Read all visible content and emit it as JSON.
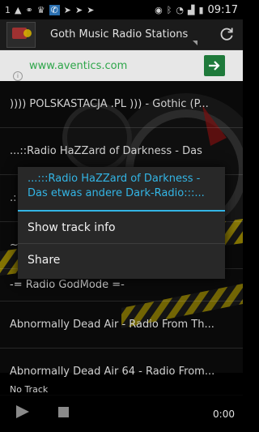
{
  "status_bar": {
    "icons": [
      "notification-1",
      "alert-icon",
      "usb-icon",
      "tux-icon",
      "app-icon",
      "send-icon",
      "send-icon",
      "send-icon"
    ],
    "right_icons": [
      "eye-icon",
      "bluetooth-icon",
      "wifi-icon",
      "signal-icon",
      "battery-icon"
    ],
    "time": "09:17"
  },
  "actionbar": {
    "title": "Goth Music Radio Stations"
  },
  "ad": {
    "url": "www.aventics.com"
  },
  "list": {
    "items": [
      ")))) POLSKASTACJA .PL ))) - Gothic (P...",
      "...::Radio HaZZard of Darkness - Das",
      ".::...",
      "~ ~",
      "-= Radio GodMode =-",
      "Abnormally Dead Air - Radio From Th...",
      "Abnormally Dead Air 64 - Radio From..."
    ]
  },
  "player": {
    "now_playing": "No Track",
    "time": "0:00"
  },
  "dialog": {
    "title_line1": "...:::Radio HaZZard of Darkness -",
    "title_line2": "Das etwas andere Dark-Radio:::...",
    "items": [
      "Show track info",
      "Share"
    ]
  },
  "colors": {
    "accent": "#33b5e5",
    "ad_url": "#2ea64a"
  }
}
